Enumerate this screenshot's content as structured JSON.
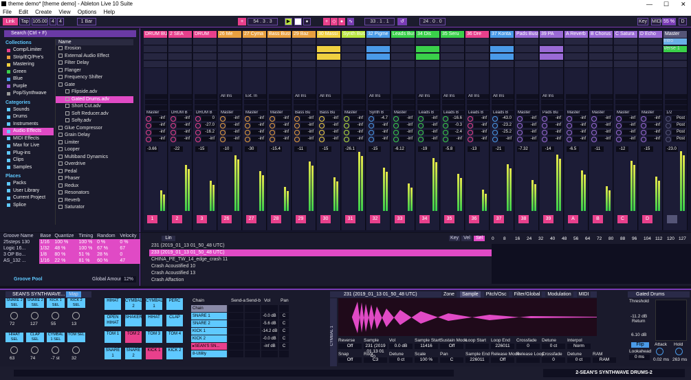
{
  "window": {
    "title": "theme demo*  [theme demo] - Ableton Live 10 Suite",
    "minimize": "—",
    "maximize": "☐",
    "close": "✕"
  },
  "menu": [
    "File",
    "Edit",
    "Create",
    "View",
    "Options",
    "Help"
  ],
  "transport": {
    "link": "Link",
    "tap": "Tap",
    "tempo": "105.00",
    "meter_num": "4",
    "meter_den": "4",
    "quantize": "1 Bar",
    "position": "54 . 3 . 3",
    "loop_start": "33 . 1 . 1",
    "loop_len": "24 . 0 . 0",
    "key": "Key",
    "midi": "MIDI",
    "cpu": "55 %",
    "d": "D"
  },
  "browser": {
    "search": "Search (Ctrl + F)",
    "collections_h": "Collections",
    "collections": [
      {
        "label": "Comp/Limiter",
        "color": "#e8408c"
      },
      {
        "label": "Strip/EQ/Pre's",
        "color": "#e8a040"
      },
      {
        "label": "Mastering",
        "color": "#f0d040"
      },
      {
        "label": "Green",
        "color": "#3ad04a"
      },
      {
        "label": "Blue",
        "color": "#4a9ae8"
      },
      {
        "label": "Purple",
        "color": "#9a5ad5"
      },
      {
        "label": "Pop/Synthwave",
        "color": "#999999"
      }
    ],
    "categories_h": "Categories",
    "categories": [
      "Sounds",
      "Drums",
      "Instruments",
      "Audio Effects",
      "MIDI Effects",
      "Max for Live",
      "Plug-ins",
      "Clips",
      "Samples"
    ],
    "places_h": "Places",
    "places": [
      "Packs",
      "User Library",
      "Current Project",
      "Splice"
    ],
    "name_h": "Name",
    "files": [
      {
        "label": "Erosion",
        "sel": false
      },
      {
        "label": "External Audio Effect",
        "sel": false
      },
      {
        "label": "Filter Delay",
        "sel": false
      },
      {
        "label": "Flanger",
        "sel": false
      },
      {
        "label": "Frequency Shifter",
        "sel": false
      },
      {
        "label": "Gate",
        "sel": false
      },
      {
        "label": "Flipside.adv",
        "sel": false
      },
      {
        "label": "Gated Drums.adv",
        "sel": true
      },
      {
        "label": "Short Cut.adv",
        "sel": false
      },
      {
        "label": "Soft Reducer.adv",
        "sel": false
      },
      {
        "label": "Softy.adv",
        "sel": false
      },
      {
        "label": "Glue Compressor",
        "sel": false
      },
      {
        "label": "Grain Delay",
        "sel": false
      },
      {
        "label": "Limiter",
        "sel": false
      },
      {
        "label": "Looper",
        "sel": false
      },
      {
        "label": "Multiband Dynamics",
        "sel": false
      },
      {
        "label": "Overdrive",
        "sel": false
      },
      {
        "label": "Pedal",
        "sel": false
      },
      {
        "label": "Phaser",
        "sel": false
      },
      {
        "label": "Redux",
        "sel": false
      },
      {
        "label": "Resonators",
        "sel": false
      },
      {
        "label": "Reverb",
        "sel": false
      },
      {
        "label": "Saturator",
        "sel": false
      }
    ]
  },
  "groove": {
    "headers": [
      "Groove Name",
      "Base",
      "Quantize",
      "Timing",
      "Random",
      "Velocity"
    ],
    "rows": [
      [
        "25steps 130",
        "1/16",
        "100 %",
        "100 %",
        "0 %",
        "0 %"
      ],
      [
        "Logic 16...",
        "1/32",
        "48 %",
        "100 %",
        "67 %",
        "67"
      ],
      [
        "3 OP Bo...",
        "1/8",
        "80 %",
        "51 %",
        "28 %",
        "0"
      ],
      [
        "AS_132 ...",
        "1/16",
        "22 %",
        "81 %",
        "60 %",
        "47"
      ]
    ],
    "pool": "Groove Pool",
    "global_label": "Global Amount",
    "global": "12%"
  },
  "tracks": [
    {
      "name": "DRUM BU",
      "color": "#e8408c",
      "num": "1",
      "vol": "-3.66",
      "sends": [
        "-inf",
        "-inf",
        "-inf",
        "-inf"
      ],
      "in": "",
      "out": "Master"
    },
    {
      "name": "2 SEA",
      "color": "#e8408c",
      "num": "2",
      "vol": "-22",
      "sends": [
        "-inf",
        "-inf",
        "-inf",
        "-inf"
      ],
      "in": "",
      "out": "DRUM B"
    },
    {
      "name": "DRUM",
      "color": "#e8408c",
      "num": "3",
      "vol": "-15",
      "sends": [
        "0",
        "-27.0",
        "-16.2",
        "-inf"
      ],
      "in": "",
      "out": "DRUM B"
    },
    {
      "name": "26 Me",
      "color": "#e8a040",
      "num": "26",
      "vol": "-10",
      "sends": [
        "-inf",
        "-inf",
        "-inf",
        "-inf"
      ],
      "in": "All Ins",
      "out": "Master"
    },
    {
      "name": "27 Cyma",
      "color": "#e8a040",
      "num": "27",
      "vol": "-30",
      "sends": [
        "-inf",
        "-inf",
        "-inf",
        "-inf"
      ],
      "in": "Ext. In",
      "out": "Master"
    },
    {
      "name": "Bass Buss",
      "color": "#e8a040",
      "num": "28",
      "vol": "-15.4",
      "out": "Master",
      "sends": [
        "-inf",
        "-inf",
        "-inf",
        "-inf"
      ],
      "in": ""
    },
    {
      "name": "29 Baz",
      "color": "#e8a040",
      "num": "29",
      "vol": "-11",
      "sends": [
        "-inf",
        "-inf",
        "-inf",
        "-inf"
      ],
      "in": "All Ins",
      "out": "Bass Bu"
    },
    {
      "name": "30 Massi",
      "color": "#f0d040",
      "num": "30",
      "vol": "-15",
      "sends": [
        "-inf",
        "-inf",
        "-inf",
        "-inf"
      ],
      "in": "All Ins",
      "out": "Bass Bu"
    },
    {
      "name": "Synth Buss",
      "color": "#b9e63e",
      "num": "31",
      "vol": "-26.1",
      "sends": [
        "-inf",
        "-inf",
        "-inf",
        "-inf"
      ],
      "in": "",
      "out": "Master"
    },
    {
      "name": "32 Pigme",
      "color": "#4a9ae8",
      "num": "32",
      "vol": "-15",
      "sends": [
        "-4.7",
        "-inf",
        "-inf",
        "-inf"
      ],
      "in": "All Ins",
      "out": "Synth B"
    },
    {
      "name": "Leads Buss",
      "color": "#3ad04a",
      "num": "33",
      "vol": "-6.12",
      "sends": [
        "-inf",
        "-inf",
        "-inf",
        "-inf"
      ],
      "in": "",
      "out": "Master"
    },
    {
      "name": "34 Dis",
      "color": "#3ad04a",
      "num": "34",
      "vol": "-19",
      "sends": [
        "-inf",
        "-inf",
        "-inf",
        "-inf"
      ],
      "in": "All Ins",
      "out": "Leads B"
    },
    {
      "name": "35 Seru",
      "color": "#3ad04a",
      "num": "35",
      "vol": "-5.8",
      "sends": [
        "-16.6",
        "-0.3",
        "-2.4",
        "-inf"
      ],
      "in": "All Ins",
      "out": "Leads B"
    },
    {
      "name": "36 Dre",
      "color": "#e8408c",
      "num": "36",
      "vol": "-13",
      "sends": [
        "-inf",
        "-inf",
        "-inf",
        "-inf"
      ],
      "in": "All Ins",
      "out": "Leads B"
    },
    {
      "name": "37 Konta",
      "color": "#4a9ae8",
      "num": "37",
      "vol": "-21",
      "sends": [
        "-43.0",
        "-23.2",
        "-25.2",
        "-inf"
      ],
      "in": "All Ins",
      "out": "Leads B"
    },
    {
      "name": "Pads Buss",
      "color": "#9a6ad5",
      "num": "38",
      "vol": "-7.32",
      "sends": [
        "-inf",
        "-inf",
        "-inf",
        "-inf"
      ],
      "in": "",
      "out": "Master"
    },
    {
      "name": "39 PA",
      "color": "#9a6ad5",
      "num": "39",
      "vol": "-14",
      "sends": [
        "-inf",
        "-inf",
        "-inf",
        "-inf"
      ],
      "in": "All Ins",
      "out": "Pads Bu"
    },
    {
      "name": "A Reverb",
      "color": "#9a6ad5",
      "num": "A",
      "vol": "-6.5",
      "sends": [
        "-inf",
        "-inf",
        "-inf",
        "-inf"
      ],
      "in": "",
      "out": "Master"
    },
    {
      "name": "B Chorus",
      "color": "#9a6ad5",
      "num": "B",
      "vol": "-11",
      "sends": [
        "-inf",
        "-inf",
        "-inf",
        "-inf"
      ],
      "in": "",
      "out": "Master"
    },
    {
      "name": "C Satura",
      "color": "#9a6ad5",
      "num": "C",
      "vol": "-12",
      "sends": [
        "-inf",
        "-inf",
        "-inf",
        "-inf"
      ],
      "in": "",
      "out": "Master"
    },
    {
      "name": "D Echo",
      "color": "#9a6ad5",
      "num": "D",
      "vol": "-15",
      "sends": [
        "-inf",
        "-inf",
        "-inf",
        "-inf"
      ],
      "in": "",
      "out": "Master"
    },
    {
      "name": "Master",
      "color": "#555577",
      "num": "",
      "vol": "-23.0",
      "sends": [
        "Post",
        "Post",
        "Post",
        "Post"
      ],
      "in": "",
      "out": "1/2"
    }
  ],
  "master_clips": [
    "Intro",
    "Verse 1"
  ],
  "clip_list": {
    "items": [
      "231 (2019_01_13 01_50_48 UTC)",
      "233 (2019_01_13 01_50_48 UTC)",
      "CHINA_PE_TW_14_edge_crash 11",
      "Crash Acoustified 10",
      "Crash Acoustified 13",
      "Crash Affaction"
    ],
    "sel_index": 1,
    "tabs": [
      "Key",
      "Vel",
      "Sel"
    ],
    "lin": "Lin",
    "ruler": [
      "0",
      "8",
      "16",
      "24",
      "32",
      "40",
      "48",
      "56",
      "64",
      "72",
      "80",
      "88",
      "96",
      "104",
      "112",
      "120",
      "127"
    ]
  },
  "drum_rack": {
    "title": "SEAN'S SYNTHWAVE...",
    "map": "Map",
    "macros": [
      {
        "label": "SNARE 2 SEL",
        "value": "72"
      },
      {
        "label": "SNARE 2 SEL",
        "value": "127"
      },
      {
        "label": "KICK 1 SEL",
        "value": "55"
      },
      {
        "label": "KICK 2 SEL",
        "value": "13"
      },
      {
        "label": "HIHAT SEL",
        "value": "63"
      },
      {
        "label": "CLAP SEL",
        "value": "74"
      },
      {
        "label": "CYMBAL 1 SEL",
        "value": "-7 st"
      },
      {
        "label": "TOM SEL",
        "value": "32"
      }
    ],
    "pads": [
      "HIHAT",
      "CYMBAL 2",
      "CYMBAL 1",
      "PERC",
      "OPEN HIHAT",
      "SHAKER",
      "HIHAT",
      "CLAP",
      "TOM 1",
      "TOM 2",
      "TOM 3",
      "TOM 4",
      "SNARE 1",
      "SNARE 2",
      "KICK 1",
      "KICK 2"
    ],
    "chain_h": [
      "Chain",
      "Send-a",
      "Send-b",
      "Vol",
      "Pan"
    ],
    "chains": [
      {
        "name": "Chain",
        "v": "",
        "p": ""
      },
      {
        "name": "SNARE 1",
        "v": "-0.0 dB",
        "p": "C"
      },
      {
        "name": "SNARE 2",
        "v": "-5.6 dB",
        "p": "C"
      },
      {
        "name": "KICK 1",
        "v": "-14.2 dB",
        "p": "C"
      },
      {
        "name": "KICK 2",
        "v": "-0.0 dB",
        "p": "C"
      },
      {
        "name": "▸SEAN'S SN...",
        "v": "-inf dB",
        "p": "C"
      },
      {
        "name": "8-Utility",
        "v": "",
        "p": ""
      }
    ]
  },
  "sampler": {
    "title": "231 (2019_01_13 01_50_48 UTC)",
    "tabs": [
      "Zone",
      "Sample",
      "Pitch/Osc",
      "Filter/Global",
      "Modulation",
      "MIDI"
    ],
    "track_label": "CYMBAL 1",
    "params": [
      {
        "label": "Reverse",
        "value": "Off"
      },
      {
        "label": "Sample",
        "value": "231 (2019 01 13 01 50 ..."
      },
      {
        "label": "Vol",
        "value": "0.0 dB"
      },
      {
        "label": "Sample Start",
        "value": "11416"
      },
      {
        "label": "Sustain Mode",
        "value": "Off"
      },
      {
        "label": "Loop Start",
        "value": ""
      },
      {
        "label": "Loop End",
        "value": "226011"
      },
      {
        "label": "Crossfade",
        "value": "0"
      },
      {
        "label": "Detune",
        "value": "0 ct"
      },
      {
        "label": "Interpol",
        "value": "Norm"
      },
      {
        "label": "Snap",
        "value": "Off"
      },
      {
        "label": "Root",
        "value": "C3"
      },
      {
        "label": "Detune",
        "value": "0 ct"
      },
      {
        "label": "Scale",
        "value": "100 %"
      },
      {
        "label": "Pan",
        "value": "C"
      },
      {
        "label": "Sample End",
        "value": "226011"
      },
      {
        "label": "Release Mode",
        "value": "Off"
      },
      {
        "label": "Release Loop",
        "value": ""
      },
      {
        "label": "Crossfade",
        "value": "0"
      },
      {
        "label": "Detune",
        "value": "0 ct"
      },
      {
        "label": "RAM",
        "value": "RAM"
      }
    ]
  },
  "gate": {
    "title": "Gated Drums",
    "threshold_l": "Threshold",
    "threshold": "-11.2 dB",
    "return_l": "Return",
    "return": "6.10 dB",
    "flip": "Flip",
    "lookahead_l": "Lookahead",
    "lookahead": "0 ms",
    "attack_l": "Attack",
    "attack": "0.02 ms",
    "hold_l": "Hold",
    "hold": "263 ms"
  },
  "status": {
    "right": "2-SEAN'S SYNTHWAVE DRUMS-2"
  }
}
